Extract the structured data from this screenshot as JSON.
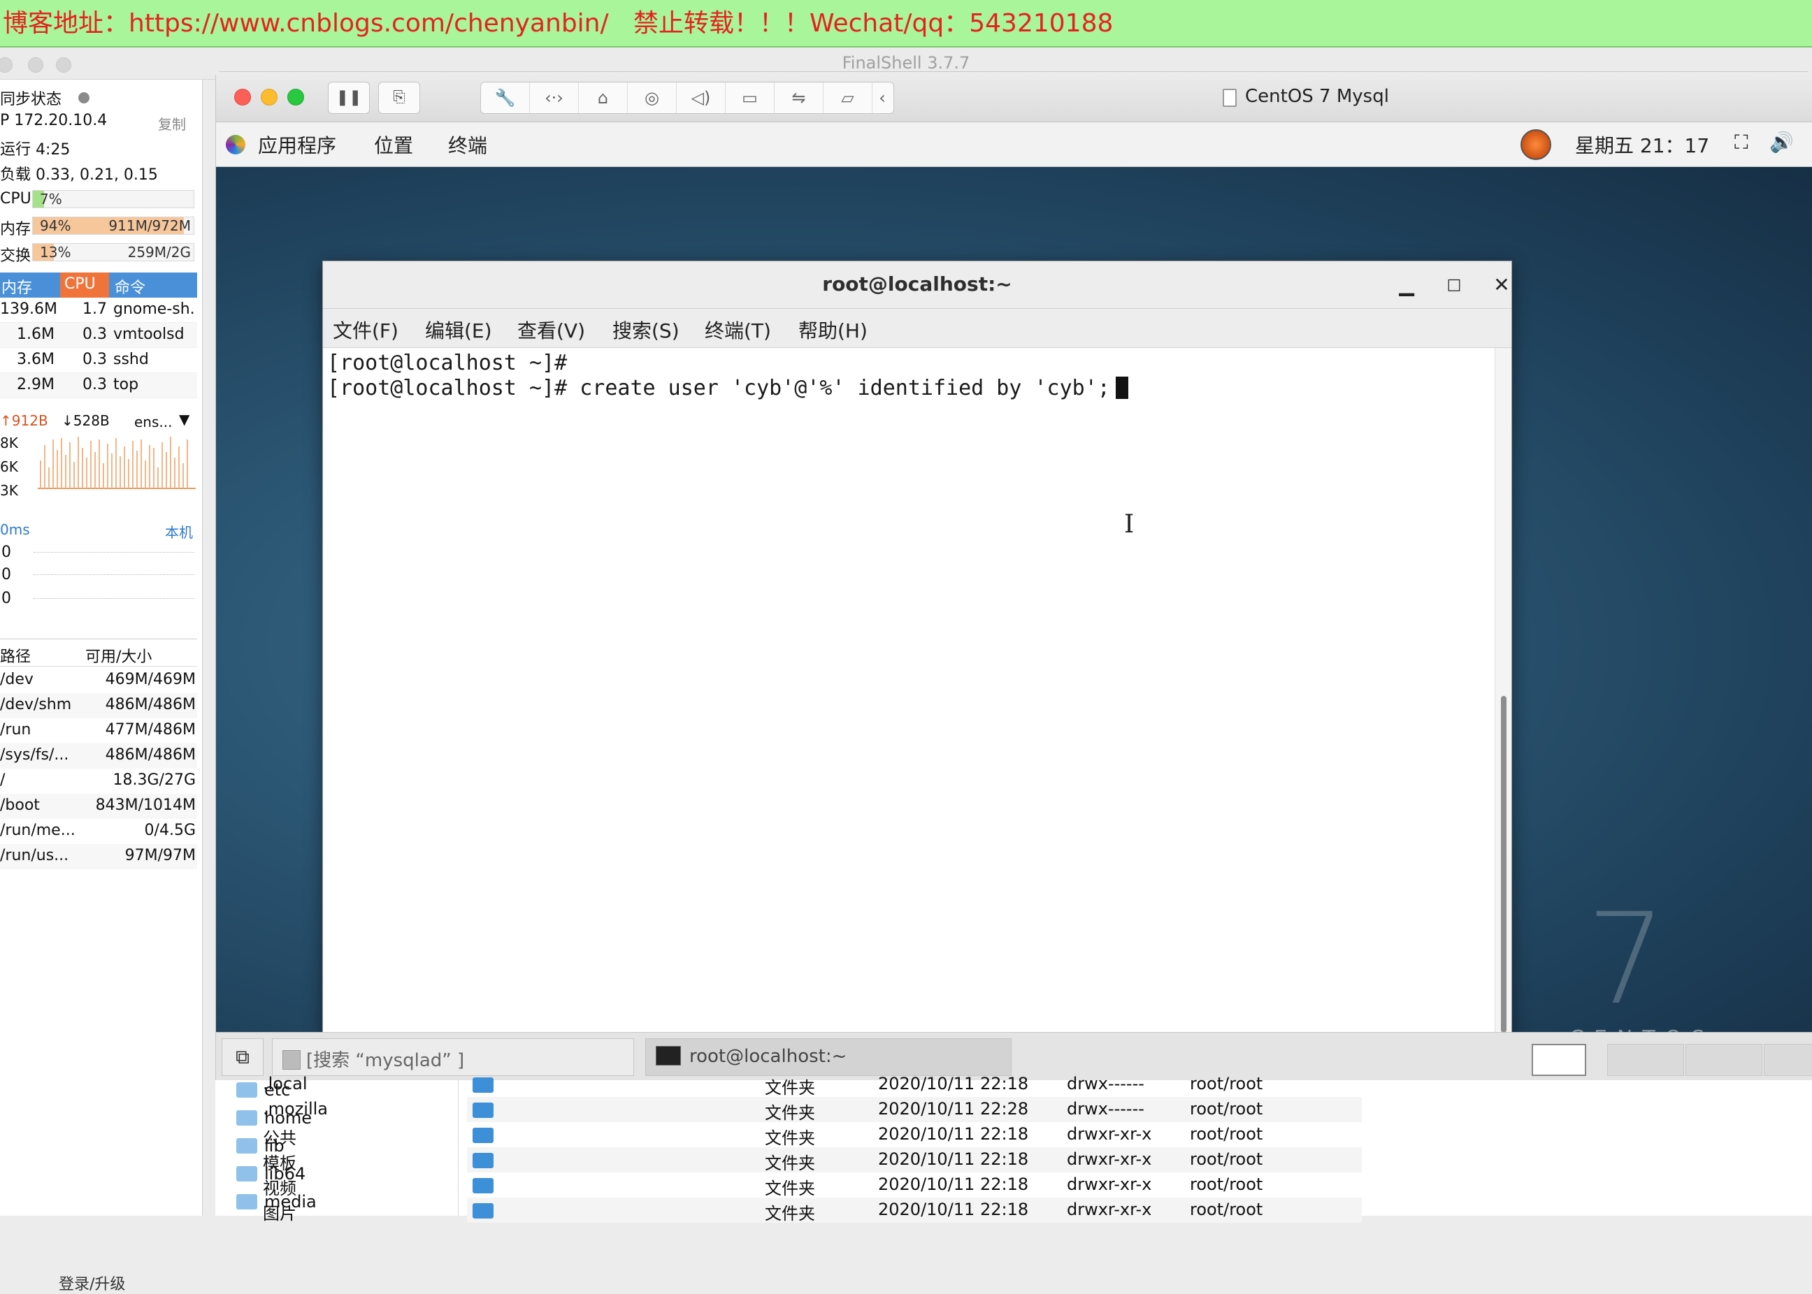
{
  "banner": {
    "left_text": "博客地址：https://www.cnblogs.com/chenyanbin/",
    "right_text": "禁止转载！！！Wechat/qq：543210188"
  },
  "host": {
    "title": "FinalShell 3.7.7"
  },
  "sidebar": {
    "sync_label": "同步状态",
    "ip_label": "P 172.20.10.4",
    "copy_label": "复制",
    "uptime": "运行 4:25",
    "load": "负载 0.33, 0.21, 0.15",
    "cpu": {
      "label": "CPU",
      "value": "7%",
      "fraction": 0.07
    },
    "mem": {
      "label": "内存",
      "value": "94%",
      "detail": "911M/972M",
      "fraction": 0.94
    },
    "swap": {
      "label": "交换",
      "value": "13%",
      "detail": "259M/2G",
      "fraction": 0.13
    },
    "proc_headers": [
      "内存",
      "CPU",
      "命令"
    ],
    "processes": [
      {
        "mem": "139.6M",
        "cpu": "1.7",
        "cmd": "gnome-sh."
      },
      {
        "mem": "1.6M",
        "cpu": "0.3",
        "cmd": "vmtoolsd"
      },
      {
        "mem": "3.6M",
        "cpu": "0.3",
        "cmd": "sshd"
      },
      {
        "mem": "2.9M",
        "cpu": "0.3",
        "cmd": "top"
      }
    ],
    "net": {
      "up": "912B",
      "down": "528B",
      "iface": "ens...",
      "ticks": [
        "8K",
        "6K",
        "3K"
      ]
    },
    "ping": {
      "label": "0ms",
      "host": "本机",
      "ticks": [
        "0",
        "0",
        "0"
      ]
    },
    "disk_headers": [
      "路径",
      "可用/大小"
    ],
    "disks": [
      {
        "path": "/dev",
        "size": "469M/469M"
      },
      {
        "path": "/dev/shm",
        "size": "486M/486M"
      },
      {
        "path": "/run",
        "size": "477M/486M"
      },
      {
        "path": "/sys/fs/...",
        "size": "486M/486M"
      },
      {
        "path": "/",
        "size": "18.3G/27G"
      },
      {
        "path": "/boot",
        "size": "843M/1014M"
      },
      {
        "path": "/run/me...",
        "size": "0/4.5G"
      },
      {
        "path": "/run/us...",
        "size": "97M/97M"
      }
    ],
    "login_label": "登录/升级"
  },
  "vm": {
    "title": "CentOS 7 Mysql",
    "panel": {
      "apps": "应用程序",
      "places": "位置",
      "terminal": "终端",
      "clock": "星期五 21：17"
    },
    "brand_digit": "7",
    "brand_word": "CENTOS",
    "terminal": {
      "title": "root@localhost:~",
      "menu": [
        "文件(F)",
        "编辑(E)",
        "查看(V)",
        "搜索(S)",
        "终端(T)",
        "帮助(H)"
      ],
      "lines": [
        "[root@localhost ~]#",
        "[root@localhost ~]# create user 'cyb'@'%' identified by 'cyb';"
      ]
    },
    "bottom_panel": {
      "search_task": "[搜索 “mysqlad” ]",
      "terminal_task": "root@localhost:~"
    }
  },
  "files": {
    "tree": [
      "etc",
      "home",
      "lib",
      "lib64",
      "media"
    ],
    "rows": [
      {
        "name": ".local",
        "type": "文件夹",
        "date": "2020/10/11 22:18",
        "perm": "drwx------",
        "owner": "root/root"
      },
      {
        "name": ".mozilla",
        "type": "文件夹",
        "date": "2020/10/11 22:28",
        "perm": "drwx------",
        "owner": "root/root"
      },
      {
        "name": "公共",
        "type": "文件夹",
        "date": "2020/10/11 22:18",
        "perm": "drwxr-xr-x",
        "owner": "root/root"
      },
      {
        "name": "模板",
        "type": "文件夹",
        "date": "2020/10/11 22:18",
        "perm": "drwxr-xr-x",
        "owner": "root/root"
      },
      {
        "name": "视频",
        "type": "文件夹",
        "date": "2020/10/11 22:18",
        "perm": "drwxr-xr-x",
        "owner": "root/root"
      },
      {
        "name": "图片",
        "type": "文件夹",
        "date": "2020/10/11 22:18",
        "perm": "drwxr-xr-x",
        "owner": "root/root"
      }
    ]
  }
}
